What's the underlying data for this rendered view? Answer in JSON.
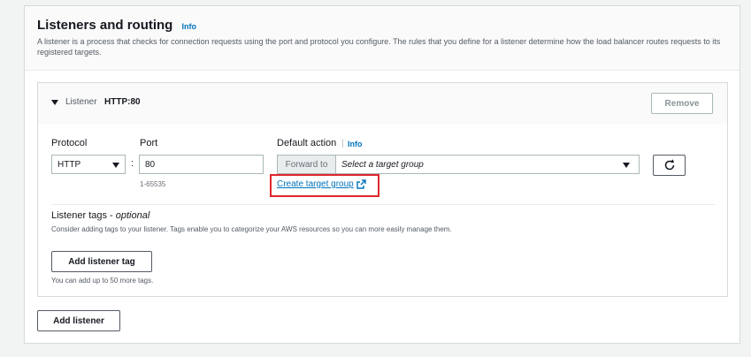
{
  "section": {
    "title": "Listeners and routing",
    "info_label": "Info",
    "description": "A listener is a process that checks for connection requests using the port and protocol you configure. The rules that you define for a listener determine how the load balancer routes requests to its registered targets."
  },
  "listener": {
    "label": "Listener",
    "protocol_port": "HTTP:80",
    "remove_label": "Remove",
    "protocol": {
      "label": "Protocol",
      "value": "HTTP"
    },
    "port": {
      "label": "Port",
      "value": "80",
      "hint": "1-65535",
      "separator": ":"
    },
    "default_action": {
      "label": "Default action",
      "info_label": "Info",
      "forward_label": "Forward to",
      "target_placeholder": "Select a target group",
      "create_link": "Create target group"
    },
    "tags": {
      "title": "Listener tags -",
      "optional": "optional",
      "description": "Consider adding tags to your listener. Tags enable you to categorize your AWS resources so you can more easily manage them.",
      "add_label": "Add listener tag",
      "hint": "You can add up to 50 more tags."
    }
  },
  "add_listener_label": "Add listener",
  "icons": {
    "caret": "caret-down-icon",
    "dropdown": "chevron-down-icon",
    "refresh": "refresh-icon",
    "external": "external-link-icon"
  },
  "colors": {
    "link": "#0073bb",
    "highlight": "#e0252b",
    "text": "#16191f",
    "muted": "#545b64"
  }
}
